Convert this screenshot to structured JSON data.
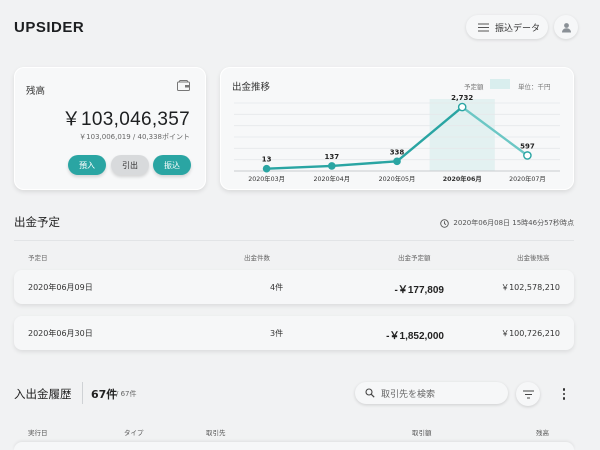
{
  "header": {
    "logo": "UPSIDER",
    "transfer_data_label": "振込データ"
  },
  "balance": {
    "title": "残高",
    "amount": "￥103,046,357",
    "sub": "￥103,006,019 / 40,338ポイント",
    "actions": [
      "預入",
      "引出",
      "振込"
    ]
  },
  "withdraw_chart": {
    "title": "出金推移",
    "legend_label": "予定額",
    "unit_label": "単位：千円"
  },
  "chart_data": {
    "type": "line",
    "categories": [
      "2020年03月",
      "2020年04月",
      "2020年05月",
      "2020年06月",
      "2020年07月"
    ],
    "values": [
      13,
      137,
      338,
      2732,
      597
    ],
    "data_labels": [
      "13",
      "137",
      "338",
      "2,732",
      "597"
    ],
    "bold_category_index": 3,
    "projected_from_index": 3,
    "ylim": [
      0,
      3000
    ],
    "grid": true,
    "line_color": "#2aa5a3",
    "projected_color": "#6cc7c5",
    "legend_placement": "top-right"
  },
  "scheduled": {
    "title": "出金予定",
    "timestamp": "2020年06月08日 15時46分57秒時点",
    "columns": [
      "予定日",
      "出金件数",
      "出金予定額",
      "出金後残高"
    ],
    "rows": [
      {
        "date": "2020年06月09日",
        "count": "4件",
        "amount": "-￥177,809",
        "after": "￥102,578,210"
      },
      {
        "date": "2020年06月30日",
        "count": "3件",
        "amount": "-￥1,852,000",
        "after": "￥100,726,210"
      }
    ]
  },
  "history": {
    "title": "入出金履歴",
    "count": "67件",
    "total": " / 67件",
    "search_placeholder": "取引先を検索",
    "columns": [
      "実行日",
      "タイプ",
      "取引先",
      "取引額",
      "残高"
    ]
  },
  "colors": {
    "accent": "#2aa5a3",
    "background": "#f1f2f3"
  }
}
